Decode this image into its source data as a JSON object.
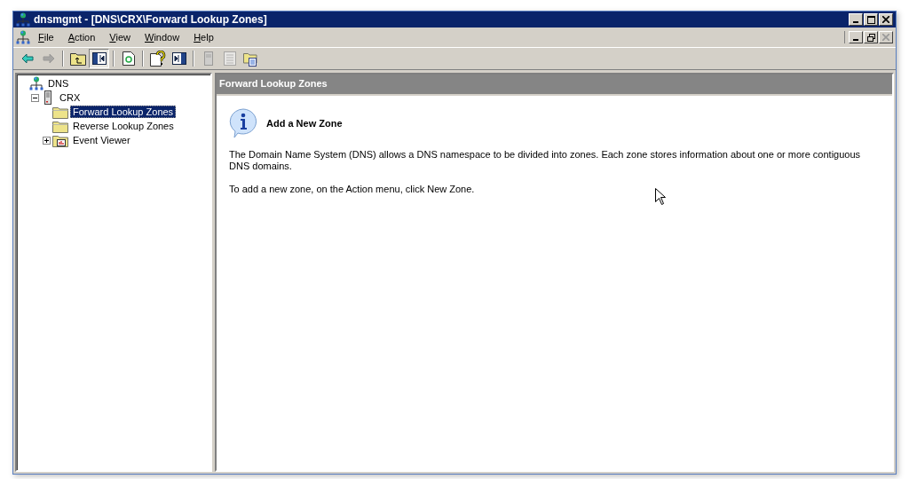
{
  "window": {
    "title": "dnsmgmt - [DNS\\CRX\\Forward Lookup Zones]"
  },
  "menu": [
    "File",
    "Action",
    "View",
    "Window",
    "Help"
  ],
  "toolbar": [
    {
      "kind": "back",
      "disabled": false,
      "selected": false
    },
    {
      "kind": "forward",
      "disabled": true,
      "selected": false
    },
    {
      "kind": "separator"
    },
    {
      "kind": "up",
      "disabled": false,
      "selected": false
    },
    {
      "kind": "tree",
      "disabled": false,
      "selected": true
    },
    {
      "kind": "separator"
    },
    {
      "kind": "refresh",
      "disabled": false,
      "selected": false
    },
    {
      "kind": "separator"
    },
    {
      "kind": "help",
      "disabled": false,
      "selected": false
    },
    {
      "kind": "panel",
      "disabled": false,
      "selected": false
    },
    {
      "kind": "separator"
    },
    {
      "kind": "server",
      "disabled": true,
      "selected": false
    },
    {
      "kind": "list",
      "disabled": true,
      "selected": false
    },
    {
      "kind": "folders",
      "disabled": false,
      "selected": false
    }
  ],
  "tree": [
    {
      "label": "DNS",
      "kind": "dns",
      "selected": false,
      "children": [
        {
          "label": "CRX",
          "kind": "server",
          "expanded": true,
          "selected": false,
          "children": [
            {
              "label": "Forward Lookup Zones",
              "kind": "folder",
              "selected": true
            },
            {
              "label": "Reverse Lookup Zones",
              "kind": "folder",
              "selected": false
            },
            {
              "label": "Event Viewer",
              "kind": "event",
              "expanded": false,
              "selected": false
            }
          ]
        }
      ]
    }
  ],
  "pane": {
    "header": "Forward Lookup Zones",
    "heading": "Add a New Zone",
    "paragraphs": [
      "The Domain Name System (DNS) allows a DNS namespace to be divided into zones. Each zone stores information about one or more contiguous DNS domains.",
      "To add a new zone, on the Action menu, click New Zone."
    ]
  }
}
